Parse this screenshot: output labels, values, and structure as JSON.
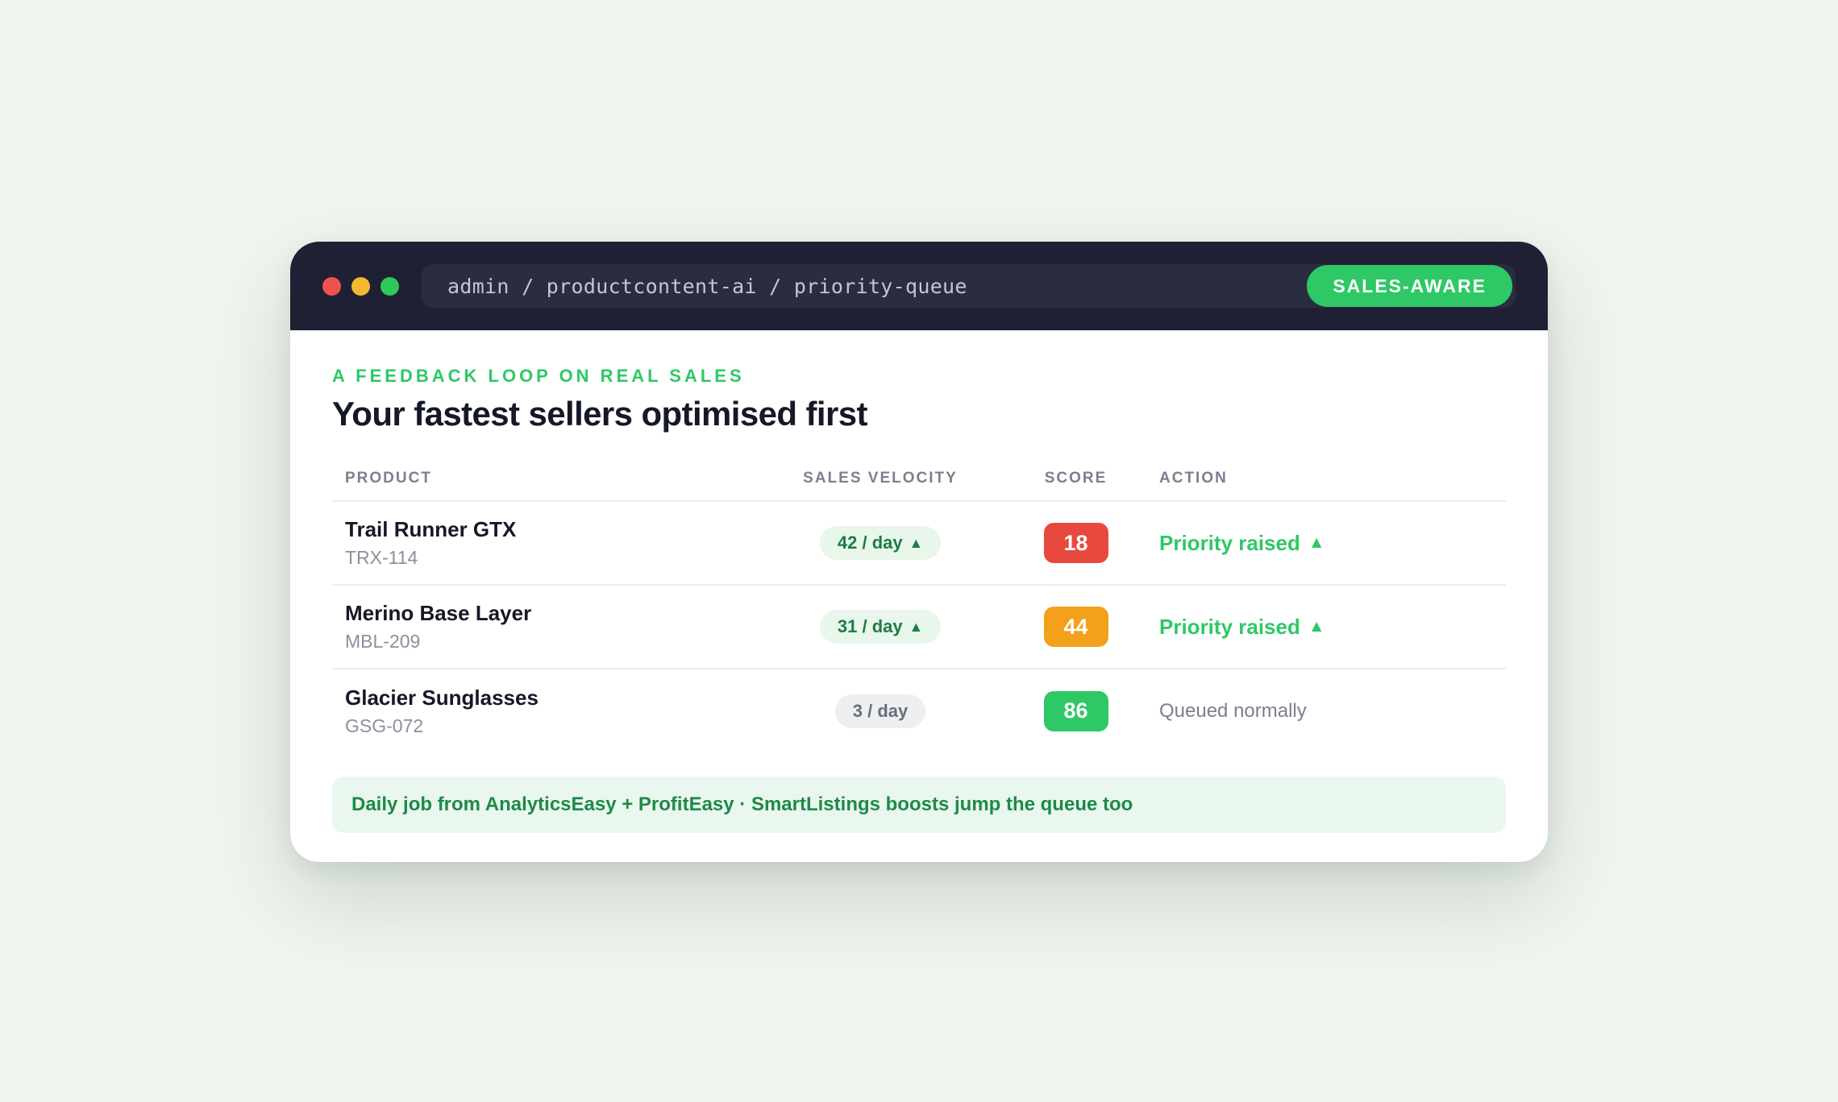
{
  "window": {
    "traffic_lights": [
      {
        "name": "close",
        "color": "#f0524d"
      },
      {
        "name": "minimize",
        "color": "#f6b730"
      },
      {
        "name": "maximize",
        "color": "#30c85a"
      }
    ],
    "path": "admin / productcontent-ai / priority-queue",
    "badge": "SALES-AWARE"
  },
  "main": {
    "eyebrow": "A FEEDBACK LOOP ON REAL SALES",
    "headline": "Your fastest sellers optimised first",
    "columns": [
      "PRODUCT",
      "SALES VELOCITY",
      "SCORE",
      "ACTION"
    ],
    "rows": [
      {
        "product": "Trail Runner GTX",
        "sku": "TRX-114",
        "velocity": "42 / day",
        "trend": "up",
        "score": "18",
        "score_color": "#e8493e",
        "action": "Priority raised",
        "action_type": "raised"
      },
      {
        "product": "Merino Base Layer",
        "sku": "MBL-209",
        "velocity": "31 / day",
        "trend": "up",
        "score": "44",
        "score_color": "#f3a11a",
        "action": "Priority raised",
        "action_type": "raised"
      },
      {
        "product": "Glacier Sunglasses",
        "sku": "GSG-072",
        "velocity": "3 / day",
        "trend": "flat",
        "score": "86",
        "score_color": "#2ec866",
        "action": "Queued normally",
        "action_type": "normal"
      }
    ],
    "footer_note": "Daily job from AnalyticsEasy + ProfitEasy · SmartListings boosts jump the queue too"
  },
  "colors": {
    "accent_green": "#2ec866",
    "titlebar_bg": "#1f2033",
    "page_bg": "#eff6ef"
  },
  "icons": {
    "trend_up": "triangle-up-icon",
    "priority_raised": "triangle-up-icon"
  }
}
